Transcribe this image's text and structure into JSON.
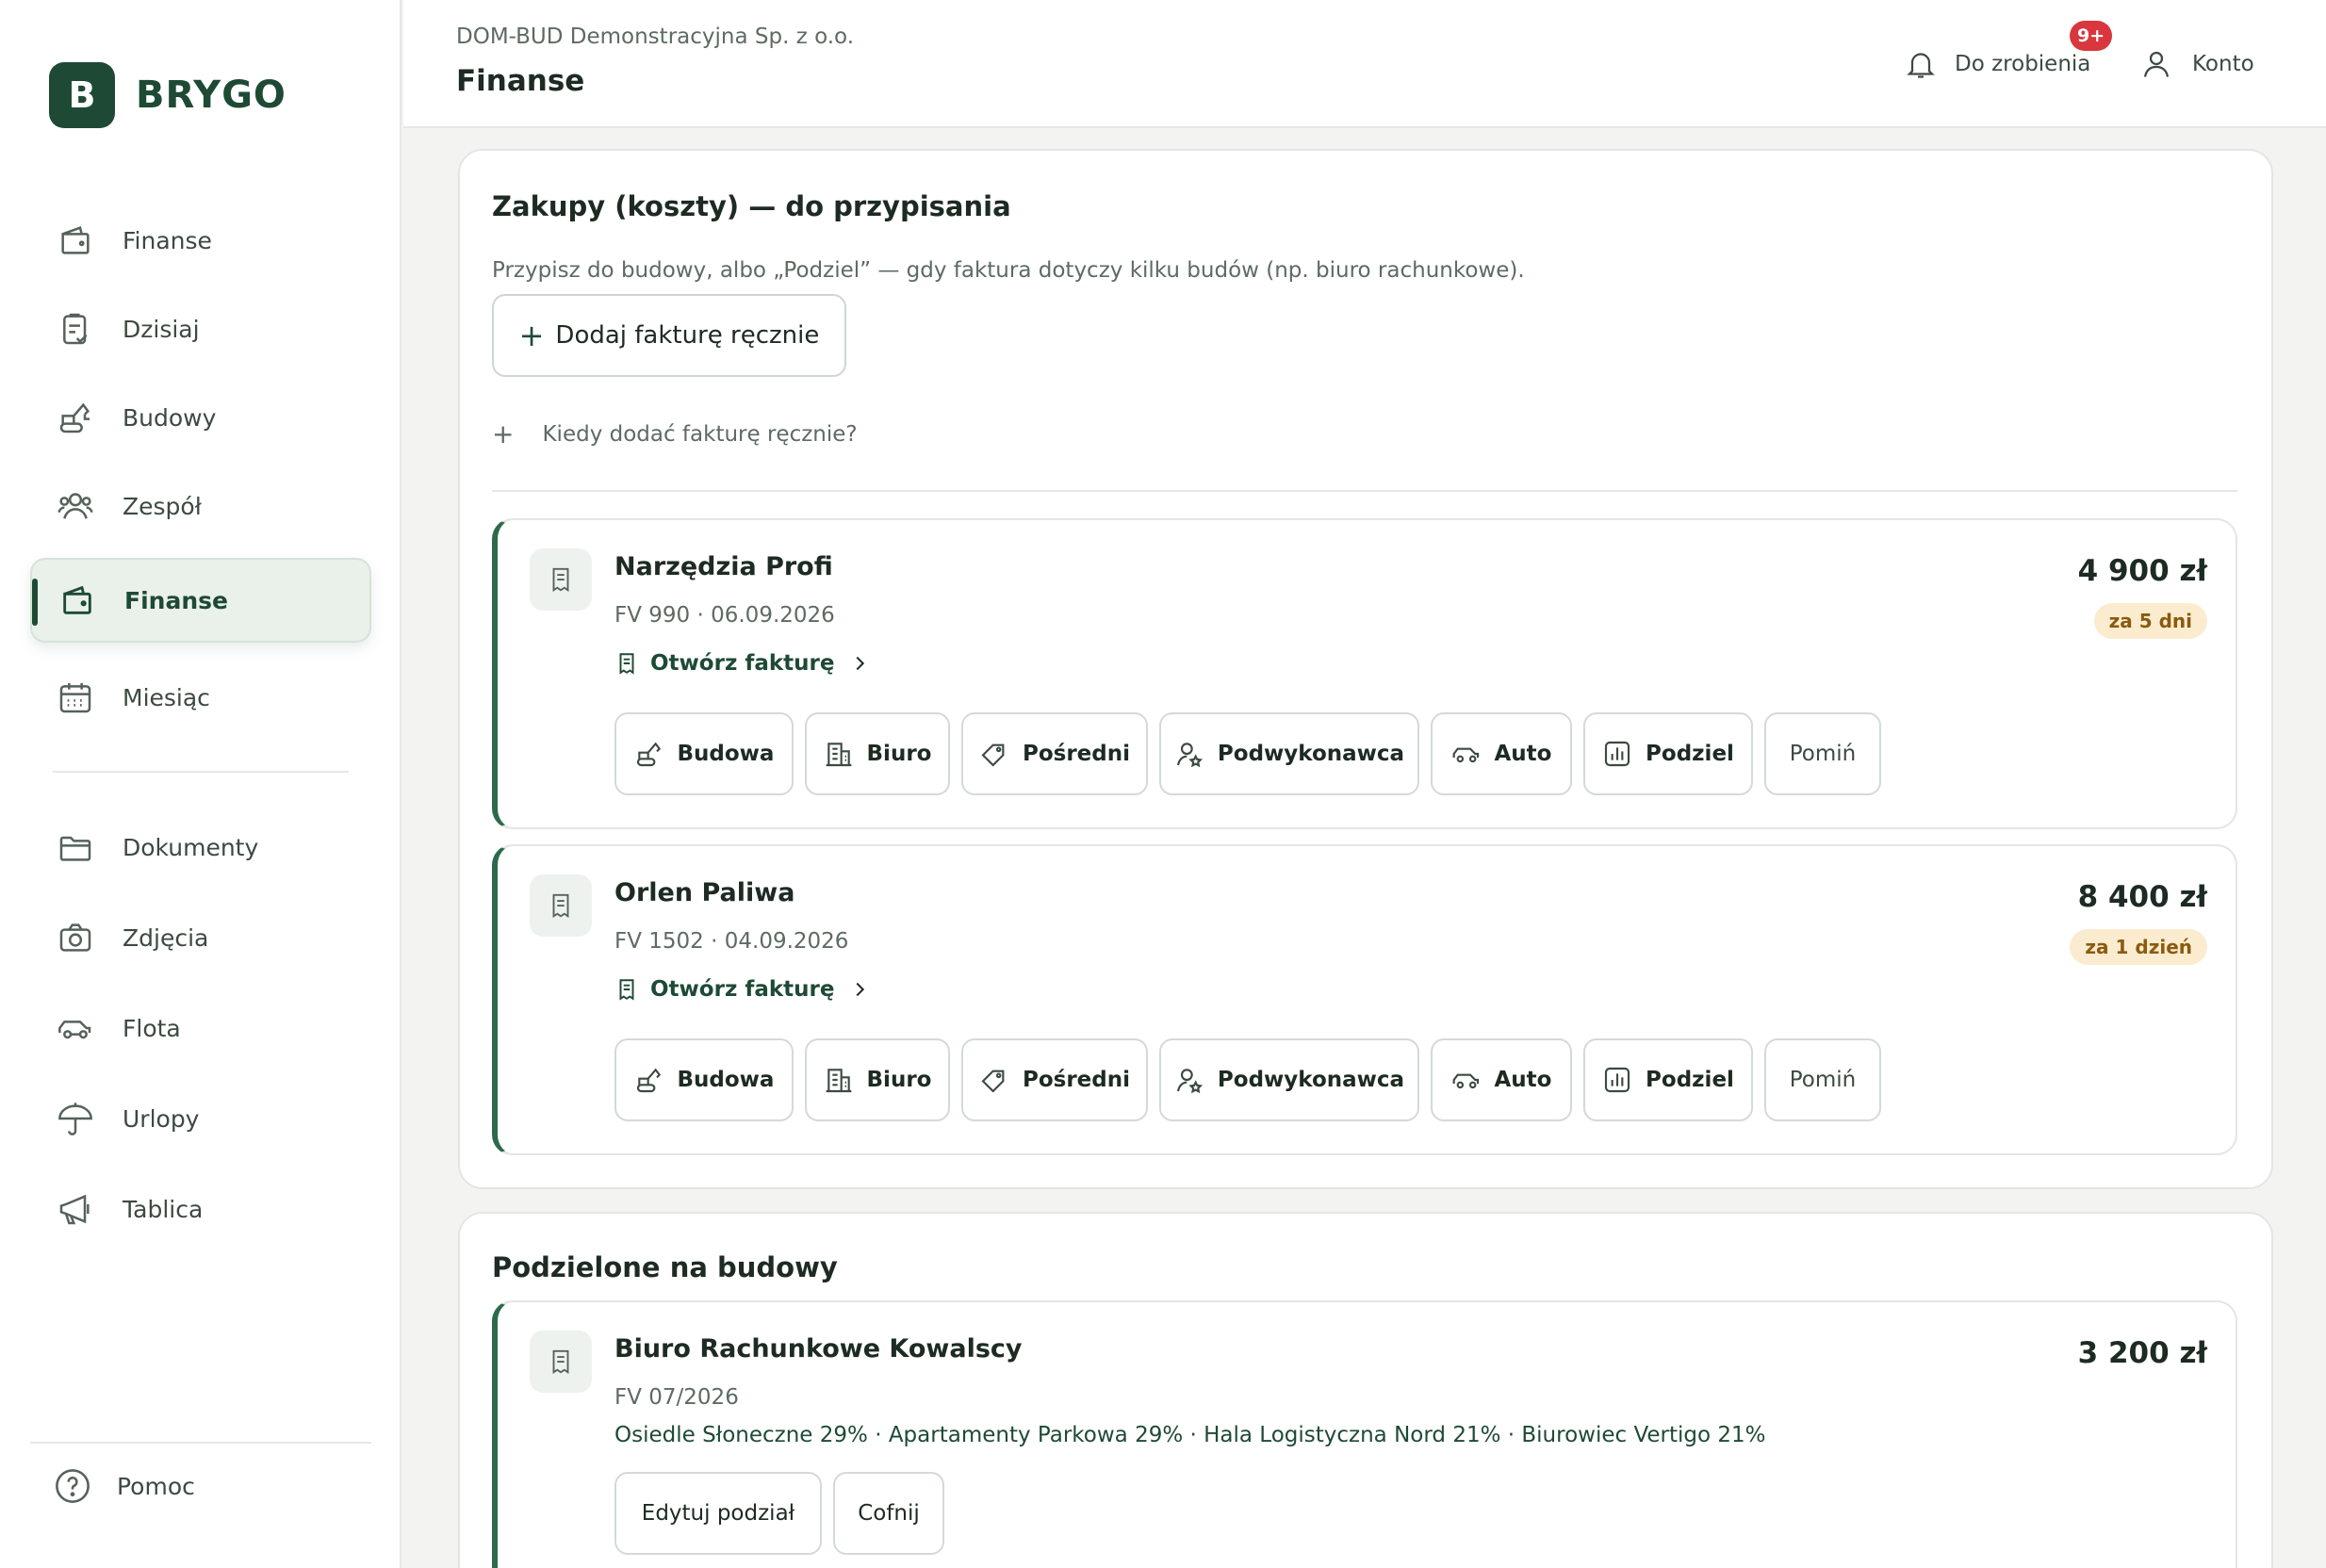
{
  "brand": {
    "logo_letter": "B",
    "name": "BRYGO"
  },
  "sidebar": {
    "items": [
      {
        "label": "Finanse",
        "icon": "wallet-icon"
      },
      {
        "label": "Dzisiaj",
        "icon": "clipboard-check-icon"
      },
      {
        "label": "Budowy",
        "icon": "excavator-icon"
      },
      {
        "label": "Zespół",
        "icon": "users-icon"
      },
      {
        "label": "Finanse",
        "icon": "wallet-icon",
        "active": true
      },
      {
        "label": "Miesiąc",
        "icon": "calendar-icon"
      },
      {
        "label": "Dokumenty",
        "icon": "folder-icon"
      },
      {
        "label": "Zdjęcia",
        "icon": "camera-icon"
      },
      {
        "label": "Flota",
        "icon": "car-icon"
      },
      {
        "label": "Urlopy",
        "icon": "umbrella-icon"
      },
      {
        "label": "Tablica",
        "icon": "megaphone-icon"
      }
    ],
    "help_label": "Pomoc"
  },
  "header": {
    "company": "DOM-BUD Demonstracyjna Sp. z o.o.",
    "title": "Finanse",
    "todo_label": "Do zrobienia",
    "todo_badge": "9+",
    "account_label": "Konto"
  },
  "unassigned": {
    "title": "Zakupy (koszty) — do przypisania",
    "description": "Przypisz do budowy, albo „Podziel” — gdy faktura dotyczy kilku budów (np. biuro rachunkowe).",
    "add_button": "Dodaj fakturę ręcznie",
    "faq_label": "Kiedy dodać fakturę ręcznie?",
    "open_invoice_label": "Otwórz fakturę",
    "action_labels": {
      "budowa": "Budowa",
      "biuro": "Biuro",
      "posredni": "Pośredni",
      "podwykonawca": "Podwykonawca",
      "auto": "Auto",
      "podziel": "Podziel",
      "pomin": "Pomiń"
    },
    "invoices": [
      {
        "vendor": "Narzędzia Profi",
        "meta": "FV 990 · 06.09.2026",
        "amount": "4 900 zł",
        "due": "za 5 dni"
      },
      {
        "vendor": "Orlen Paliwa",
        "meta": "FV 1502 · 04.09.2026",
        "amount": "8 400 zł",
        "due": "za 1 dzień"
      }
    ]
  },
  "split_section": {
    "title": "Podzielone na budowy",
    "items": [
      {
        "vendor": "Biuro Rachunkowe Kowalscy",
        "meta": "FV 07/2026",
        "amount": "3 200 zł",
        "split": "Osiedle Słoneczne 29% · Apartamenty Parkowa 29% · Hala Logistyczna Nord 21% · Biurowiec Vertigo 21%",
        "edit_label": "Edytuj podział",
        "undo_label": "Cofnij"
      }
    ]
  },
  "colors": {
    "brand": "#1e4a35",
    "accent": "#2d6a4b",
    "badge": "#d9363e",
    "due_bg": "#fbeccf"
  }
}
